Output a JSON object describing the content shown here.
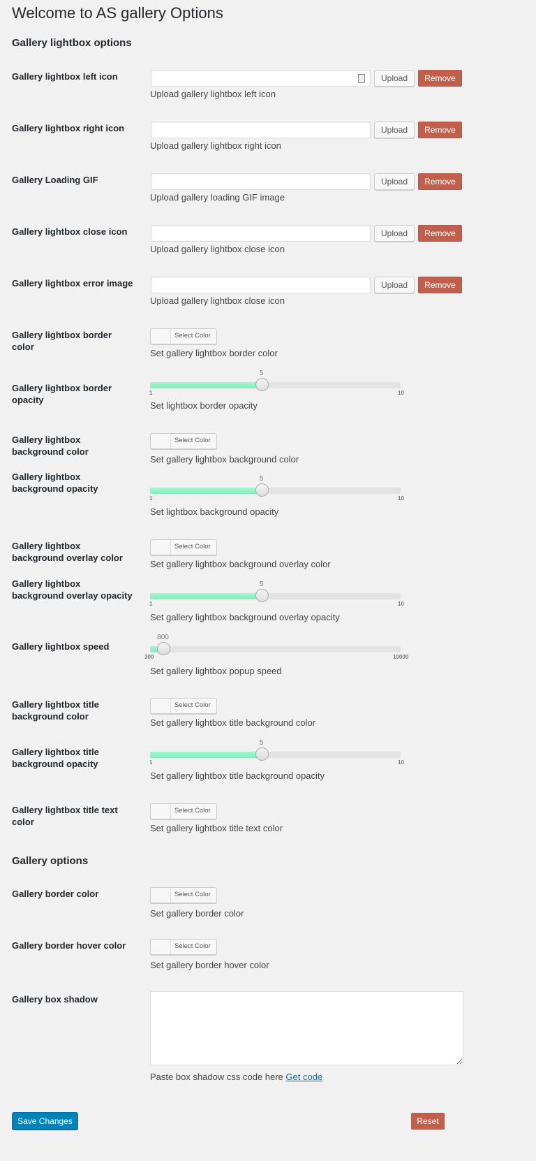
{
  "page_title": "Welcome to AS gallery Options",
  "sections": [
    {
      "heading": "Gallery lightbox options",
      "fields": [
        {
          "type": "upload",
          "label": "Gallery lightbox left icon",
          "value": "",
          "upload_label": "Upload",
          "remove_label": "Remove",
          "description": "Upload gallery lightbox left icon",
          "has_autofill_icon": true
        },
        {
          "type": "upload",
          "label": "Gallery lightbox right icon",
          "value": "",
          "upload_label": "Upload",
          "remove_label": "Remove",
          "description": "Upload gallery lightbox right icon"
        },
        {
          "type": "upload",
          "label": "Gallery Loading GIF",
          "value": "",
          "upload_label": "Upload",
          "remove_label": "Remove",
          "description": "Upload gallery loading GIF image"
        },
        {
          "type": "upload",
          "label": "Gallery lightbox close icon",
          "value": "",
          "upload_label": "Upload",
          "remove_label": "Remove",
          "description": "Upload gallery lightbox close icon"
        },
        {
          "type": "upload",
          "label": "Gallery lightbox error image",
          "value": "",
          "upload_label": "Upload",
          "remove_label": "Remove",
          "description": "Upload gallery lightbox close icon"
        },
        {
          "type": "color",
          "label": "Gallery lightbox border color",
          "button_label": "Select Color",
          "description": "Set gallery lightbox border color"
        },
        {
          "type": "slider",
          "label": "Gallery lightbox border opacity",
          "value": 5,
          "min": 1,
          "max": 10,
          "value_label": "5",
          "min_label": "1",
          "max_label": "10",
          "description": "Set lightbox border opacity"
        },
        {
          "type": "color",
          "label": "Gallery lightbox background color",
          "button_label": "Select Color",
          "description": "Set gallery lightbox background color"
        },
        {
          "type": "slider",
          "label": "Gallery lightbox background opacity",
          "value": 5,
          "min": 1,
          "max": 10,
          "value_label": "5",
          "min_label": "1",
          "max_label": "10",
          "description": "Set lightbox background opacity"
        },
        {
          "type": "color",
          "label": "Gallery lightbox background overlay color",
          "button_label": "Select Color",
          "description": "Set gallery lightbox background overlay color"
        },
        {
          "type": "slider",
          "label": "Gallery lightbox background overlay opacity",
          "value": 5,
          "min": 1,
          "max": 10,
          "value_label": "5",
          "min_label": "1",
          "max_label": "10",
          "description": "Set gallery lightbox background overlay opacity"
        },
        {
          "type": "slider",
          "label": "Gallery lightbox speed",
          "value": 800,
          "min": 300,
          "max": 10000,
          "value_label": "800",
          "min_label": "300",
          "max_label": "10000",
          "description": "Set gallery lightbox popup speed"
        },
        {
          "type": "color",
          "label": "Gallery lightbox title background color",
          "button_label": "Select Color",
          "description": "Set gallery lightbox title background color"
        },
        {
          "type": "slider",
          "label": "Gallery lightbox title background opacity",
          "value": 5,
          "min": 1,
          "max": 10,
          "value_label": "5",
          "min_label": "1",
          "max_label": "10",
          "description": "Set gallery lightbox title background opacity"
        },
        {
          "type": "color",
          "label": "Gallery lightbox title text color",
          "button_label": "Select Color",
          "description": "Set gallery lightbox title text color"
        }
      ]
    },
    {
      "heading": "Gallery options",
      "fields": [
        {
          "type": "color",
          "label": "Gallery border color",
          "button_label": "Select Color",
          "description": "Set gallery border color"
        },
        {
          "type": "color",
          "label": "Gallery border hover color",
          "button_label": "Select Color",
          "description": "Set gallery border hover color"
        },
        {
          "type": "textarea",
          "label": "Gallery box shadow",
          "value": "",
          "description": "Paste box shadow css code here",
          "link_label": "Get code"
        }
      ]
    }
  ],
  "footer": {
    "save_label": "Save Changes",
    "reset_label": "Reset"
  },
  "colors": {
    "accent": "#0085ba",
    "danger": "#c0604c",
    "slider_fill": "#90f0c3",
    "background": "#f1f1f1"
  }
}
